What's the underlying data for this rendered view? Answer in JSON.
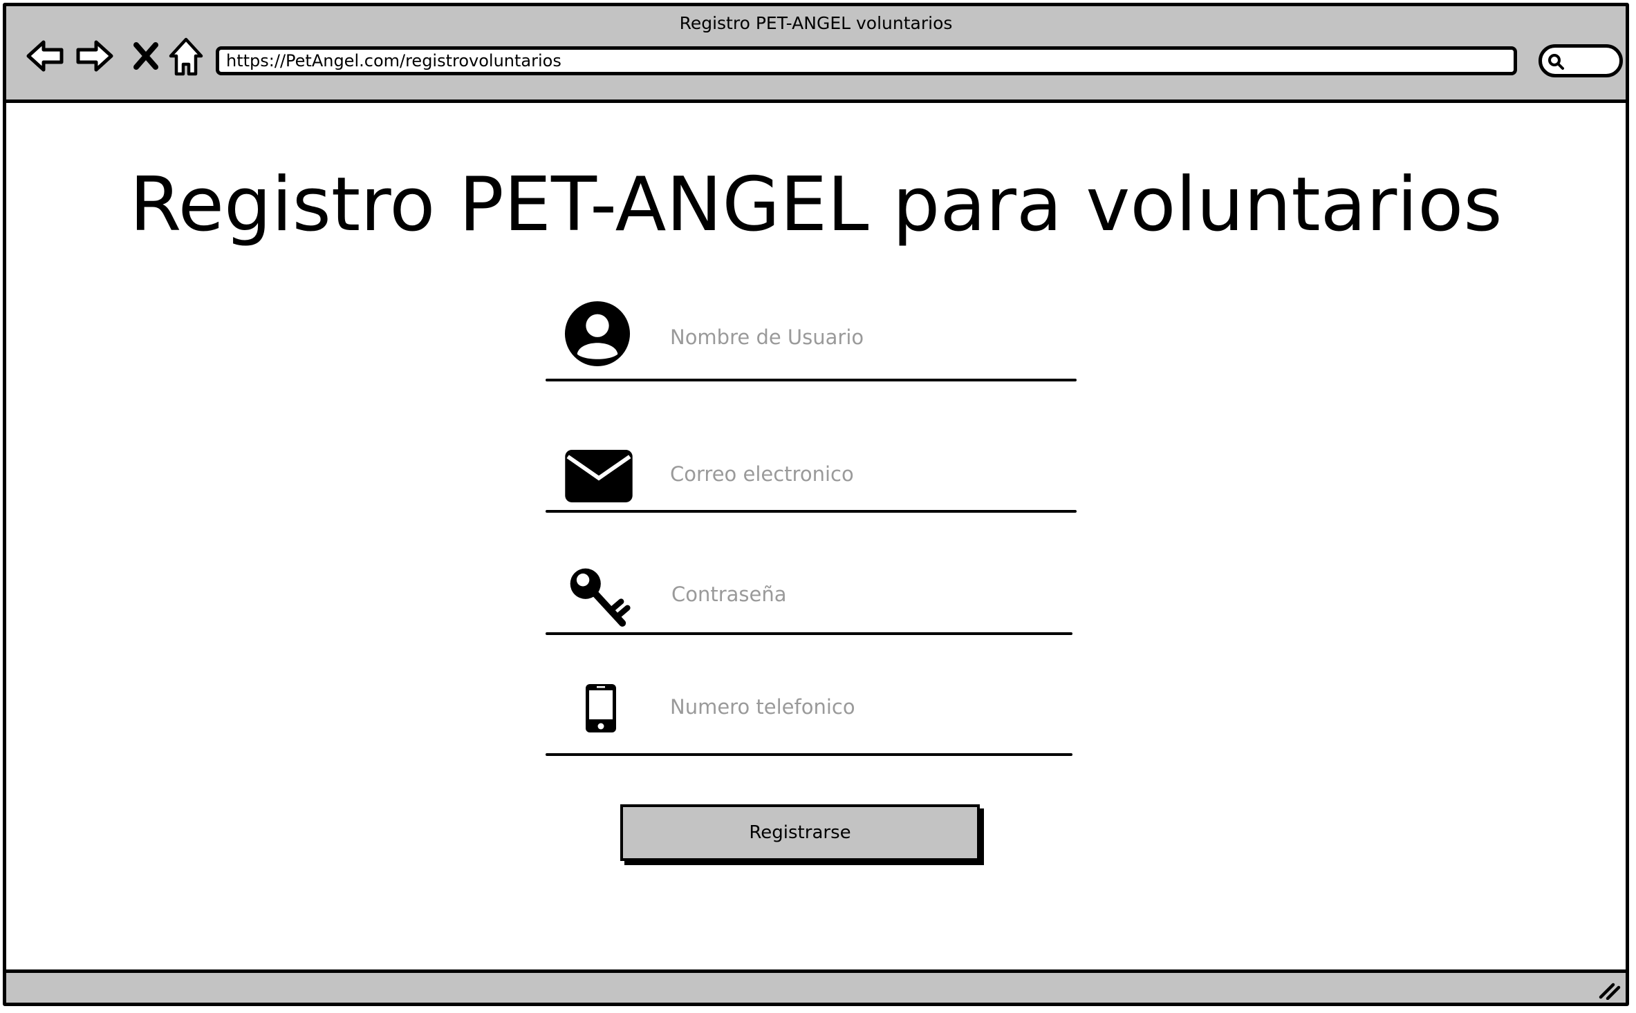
{
  "window": {
    "title": "Registro PET-ANGEL voluntarios"
  },
  "toolbar": {
    "buttons": [
      {
        "name": "back-arrow-icon"
      },
      {
        "name": "forward-arrow-icon"
      },
      {
        "name": "close-x-icon"
      },
      {
        "name": "home-icon"
      }
    ],
    "url": "https://PetAngel.com/registrovoluntarios",
    "search_icon": "search-icon"
  },
  "page": {
    "heading": "Registro PET-ANGEL para voluntarios"
  },
  "form": {
    "fields": [
      {
        "icon": "user-avatar-icon",
        "placeholder": "Nombre de Usuario"
      },
      {
        "icon": "envelope-icon",
        "placeholder": "Correo electronico"
      },
      {
        "icon": "key-icon",
        "placeholder": "Contraseña"
      },
      {
        "icon": "mobile-phone-icon",
        "placeholder": "Numero telefonico"
      }
    ],
    "submit_label": "Registrarse"
  },
  "colors": {
    "chrome": "#c3c3c3",
    "placeholder_text": "#9a9a9a",
    "outline": "#000000"
  }
}
